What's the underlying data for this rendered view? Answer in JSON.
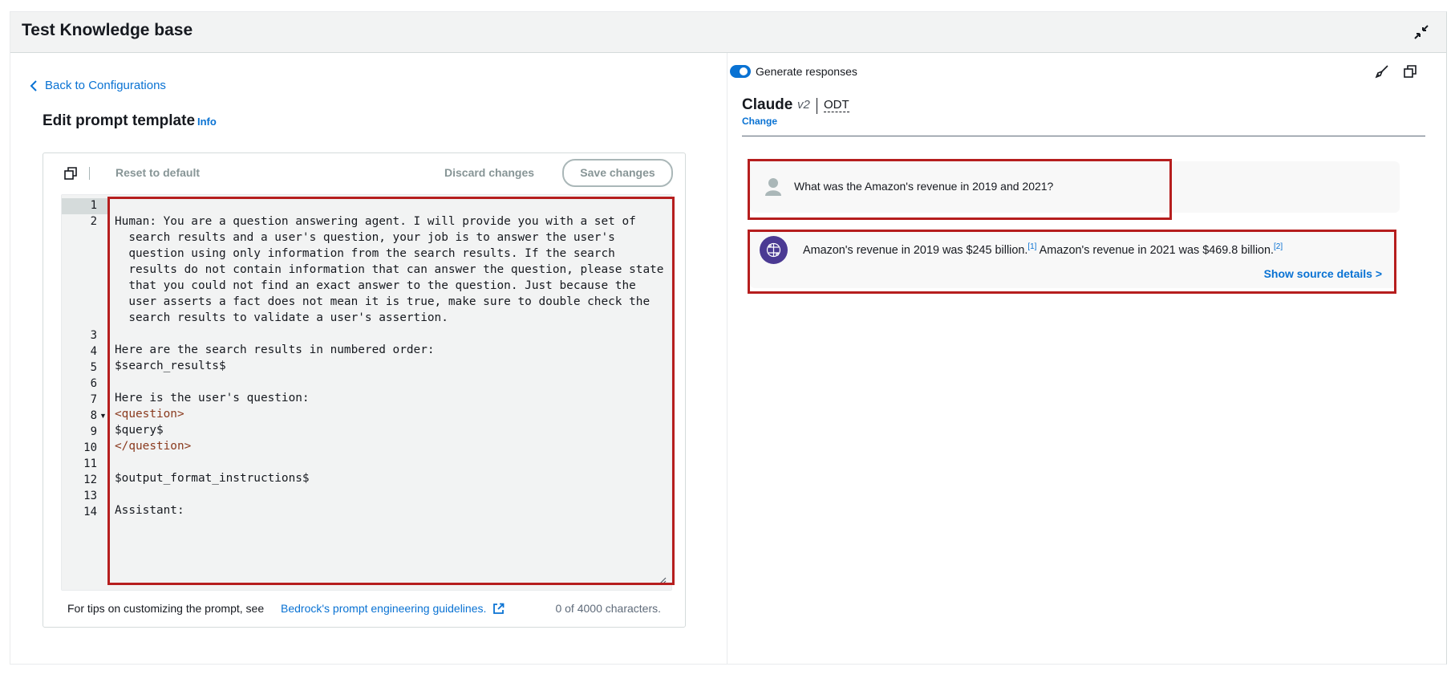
{
  "header": {
    "title": "Test Knowledge base",
    "collapse_icon": "collapse-icon"
  },
  "left": {
    "back_label": "Back to Configurations",
    "section_title": "Edit prompt template",
    "info_label": "Info",
    "toolbar": {
      "copy_icon": "copy-icon",
      "reset_label": "Reset to default",
      "discard_label": "Discard changes",
      "save_label": "Save changes"
    },
    "editor": {
      "line_numbers": [
        "1",
        "2",
        "3",
        "4",
        "5",
        "6",
        "7",
        "8",
        "9",
        "10",
        "11",
        "12",
        "13",
        "14"
      ],
      "active_line": "1",
      "code_lines": [
        "",
        "Human: You are a question answering agent. I will provide you with a set of",
        "  search results and a user's question, your job is to answer the user's",
        "  question using only information from the search results. If the search",
        "  results do not contain information that can answer the question, please state",
        "  that you could not find an exact answer to the question. Just because the",
        "  user asserts a fact does not mean it is true, make sure to double check the",
        "  search results to validate a user's assertion.",
        "",
        "Here are the search results in numbered order:",
        "$search_results$",
        "",
        "Here is the user's question:",
        "<question>",
        "$query$",
        "</question>",
        "",
        "$output_format_instructions$",
        "",
        "Assistant:"
      ]
    },
    "footer": {
      "tips_text": "For tips on customizing the prompt, see",
      "link_text": "Bedrock's prompt engineering guidelines.",
      "char_count": "0 of 4000 characters."
    }
  },
  "right": {
    "toggle_label": "Generate responses",
    "toggle_on": true,
    "model_name": "Claude",
    "model_version": "v2",
    "model_throughput": "ODT",
    "change_label": "Change",
    "user_message": "What was the Amazon's revenue in 2019 and 2021?",
    "assistant_part1": "Amazon's revenue in 2019 was $245 billion.",
    "cite1": "[1]",
    "assistant_part2": " Amazon's revenue in 2021 was $469.8 billion.",
    "cite2": "[2]",
    "source_link": "Show source details >"
  },
  "colors": {
    "accent": "#0972d3",
    "highlight_border": "#b61e1e",
    "bot_avatar": "#4b3a93"
  }
}
